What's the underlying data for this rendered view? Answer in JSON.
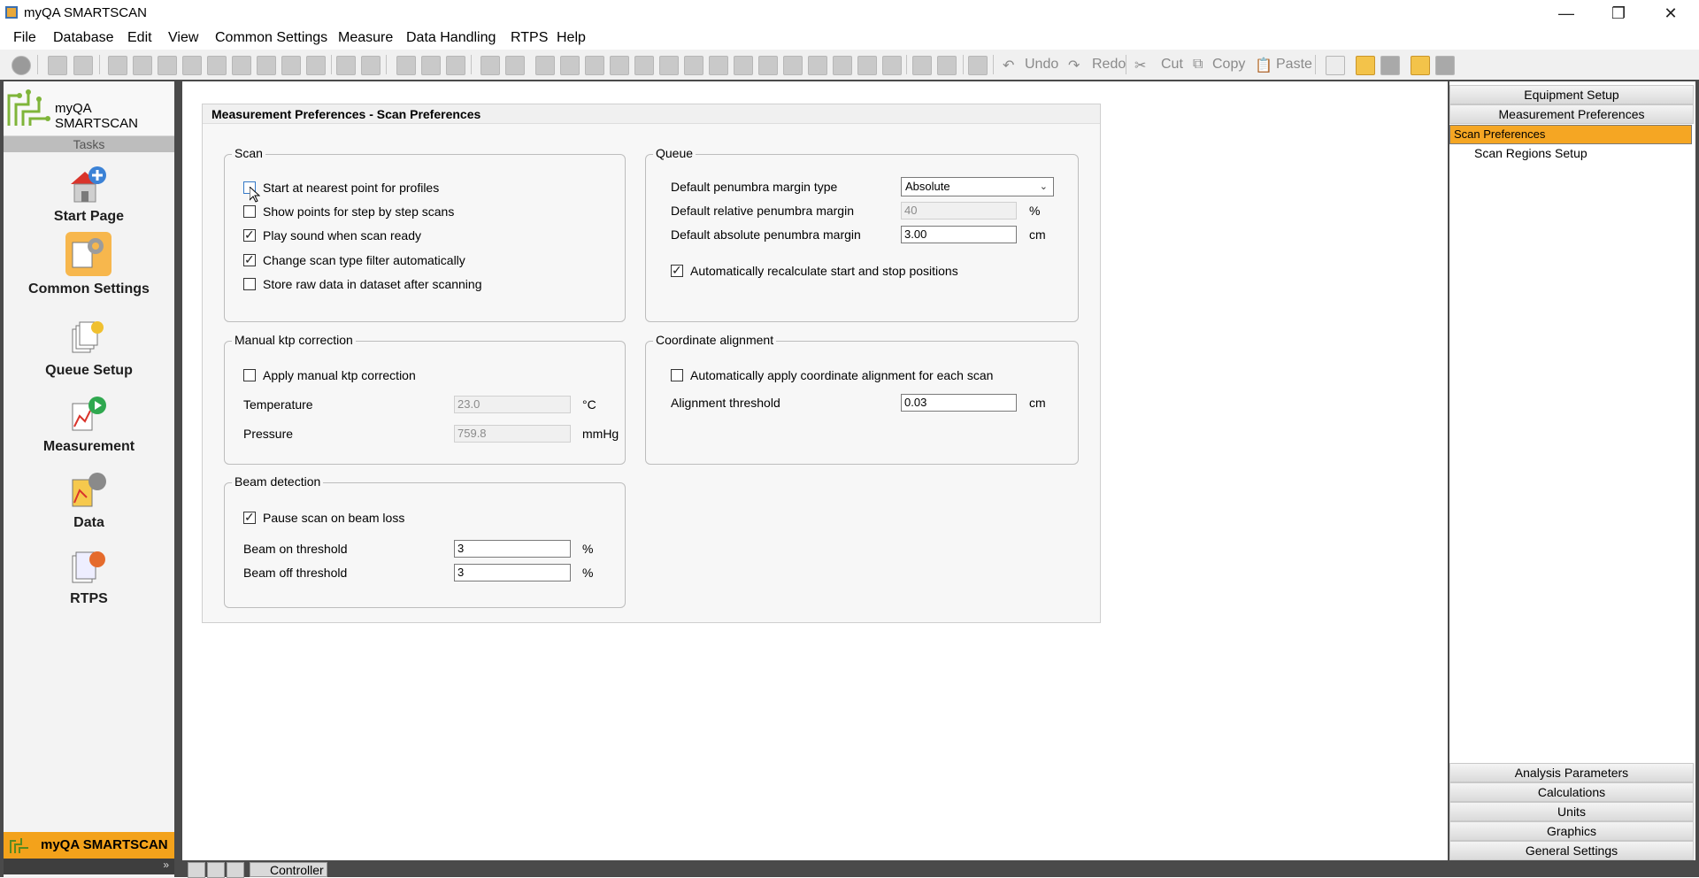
{
  "window": {
    "title": "myQA SMARTSCAN"
  },
  "menu": [
    "File",
    "Database",
    "Edit",
    "View",
    "Common Settings",
    "Measure",
    "Data Handling",
    "RTPS",
    "Help"
  ],
  "toolbar": {
    "undo": "Undo",
    "redo": "Redo",
    "cut": "Cut",
    "copy": "Copy",
    "paste": "Paste"
  },
  "left_panel": {
    "brand": "myQA SMARTSCAN",
    "tasks_header": "Tasks",
    "tasks": [
      "Start Page",
      "Common Settings",
      "Queue Setup",
      "Measurement",
      "Data",
      "RTPS"
    ],
    "bottom_brand": "myQA SMARTSCAN",
    "expander": "»"
  },
  "dialog": {
    "title": "Measurement Preferences - Scan Preferences",
    "scan": {
      "title": "Scan",
      "items": [
        {
          "label": "Start at nearest point for profiles",
          "checked": false
        },
        {
          "label": "Show points for step by step scans",
          "checked": false
        },
        {
          "label": "Play sound when scan ready",
          "checked": true
        },
        {
          "label": "Change scan type filter automatically",
          "checked": true
        },
        {
          "label": "Store raw data in dataset after scanning",
          "checked": false
        }
      ]
    },
    "queue": {
      "title": "Queue",
      "penumbra_type_label": "Default penumbra margin type",
      "penumbra_type_value": "Absolute",
      "relative_label": "Default relative penumbra margin",
      "relative_value": "40",
      "relative_unit": "%",
      "absolute_label": "Default absolute penumbra margin",
      "absolute_value": "3.00",
      "absolute_unit": "cm",
      "recalc_label": "Automatically recalculate start and stop positions",
      "recalc_checked": true
    },
    "ktp": {
      "title": "Manual ktp correction",
      "apply_label": "Apply manual ktp correction",
      "apply_checked": false,
      "temperature_label": "Temperature",
      "temperature_value": "23.0",
      "temperature_unit": "°C",
      "pressure_label": "Pressure",
      "pressure_value": "759.8",
      "pressure_unit": "mmHg"
    },
    "coord": {
      "title": "Coordinate alignment",
      "apply_label": "Automatically apply coordinate alignment for each scan",
      "apply_checked": false,
      "threshold_label": "Alignment threshold",
      "threshold_value": "0.03",
      "threshold_unit": "cm"
    },
    "beam": {
      "title": "Beam detection",
      "pause_label": "Pause scan on beam loss",
      "pause_checked": true,
      "on_label": "Beam on threshold",
      "on_value": "3",
      "on_unit": "%",
      "off_label": "Beam off threshold",
      "off_value": "3",
      "off_unit": "%"
    }
  },
  "right_panel": {
    "top_headers": [
      "Equipment Setup",
      "Measurement Preferences"
    ],
    "items": [
      "Scan Preferences",
      "Scan Regions Setup"
    ],
    "selected_index": 0,
    "bottom_headers": [
      "Analysis Parameters",
      "Calculations",
      "Units",
      "Graphics",
      "General Settings"
    ]
  },
  "statusbar": {
    "controller_tab": "Controller"
  },
  "colors": {
    "accent": "#f5a623",
    "frame": "#4a4a4a"
  }
}
